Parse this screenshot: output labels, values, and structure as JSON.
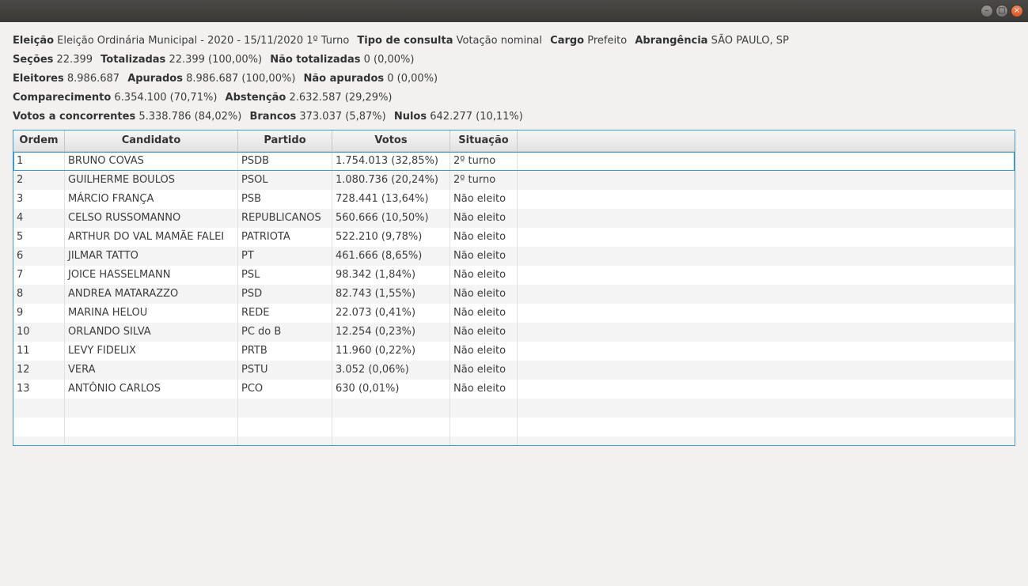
{
  "window": {
    "buttons": {
      "minimize": "–",
      "maximize": "□",
      "close": "×"
    }
  },
  "summary": {
    "line1": {
      "eleicao_label": "Eleição",
      "eleicao_value": "Eleição Ordinária Municipal - 2020 - 15/11/2020 1º Turno",
      "tipo_label": "Tipo de consulta",
      "tipo_value": "Votação nominal",
      "cargo_label": "Cargo",
      "cargo_value": "Prefeito",
      "abrangencia_label": "Abrangência",
      "abrangencia_value": "SÃO PAULO, SP"
    },
    "line2": {
      "secoes_label": "Seções",
      "secoes_value": "22.399",
      "totalizadas_label": "Totalizadas",
      "totalizadas_value": "22.399 (100,00%)",
      "nao_totalizadas_label": "Não totalizadas",
      "nao_totalizadas_value": "0 (0,00%)"
    },
    "line3": {
      "eleitores_label": "Eleitores",
      "eleitores_value": "8.986.687",
      "apurados_label": "Apurados",
      "apurados_value": "8.986.687 (100,00%)",
      "nao_apurados_label": "Não apurados",
      "nao_apurados_value": "0 (0,00%)"
    },
    "line4": {
      "comparecimento_label": "Comparecimento",
      "comparecimento_value": "6.354.100 (70,71%)",
      "abstencao_label": "Abstenção",
      "abstencao_value": "2.632.587 (29,29%)"
    },
    "line5": {
      "votos_label": "Votos a concorrentes",
      "votos_value": "5.338.786 (84,02%)",
      "brancos_label": "Brancos",
      "brancos_value": "373.037 (5,87%)",
      "nulos_label": "Nulos",
      "nulos_value": "642.277 (10,11%)"
    }
  },
  "table": {
    "columns": [
      "Ordem",
      "Candidato",
      "Partido",
      "Votos",
      "Situação"
    ],
    "rows": [
      [
        "1",
        "BRUNO COVAS",
        "PSDB",
        "1.754.013 (32,85%)",
        "2º turno"
      ],
      [
        "2",
        "GUILHERME BOULOS",
        "PSOL",
        "1.080.736 (20,24%)",
        "2º turno"
      ],
      [
        "3",
        "MÁRCIO FRANÇA",
        "PSB",
        "728.441 (13,64%)",
        "Não eleito"
      ],
      [
        "4",
        "CELSO RUSSOMANNO",
        "REPUBLICANOS",
        "560.666 (10,50%)",
        "Não eleito"
      ],
      [
        "5",
        "ARTHUR DO VAL MAMÃE FALEI",
        "PATRIOTA",
        "522.210 (9,78%)",
        "Não eleito"
      ],
      [
        "6",
        "JILMAR TATTO",
        "PT",
        "461.666 (8,65%)",
        "Não eleito"
      ],
      [
        "7",
        "JOICE HASSELMANN",
        "PSL",
        "98.342 (1,84%)",
        "Não eleito"
      ],
      [
        "8",
        "ANDREA MATARAZZO",
        "PSD",
        "82.743 (1,55%)",
        "Não eleito"
      ],
      [
        "9",
        "MARINA HELOU",
        "REDE",
        "22.073 (0,41%)",
        "Não eleito"
      ],
      [
        "10",
        "ORLANDO SILVA",
        "PC do B",
        "12.254 (0,23%)",
        "Não eleito"
      ],
      [
        "11",
        "LEVY FIDELIX",
        "PRTB",
        "11.960 (0,22%)",
        "Não eleito"
      ],
      [
        "12",
        "VERA",
        "PSTU",
        "3.052 (0,06%)",
        "Não eleito"
      ],
      [
        "13",
        "ANTÔNIO CARLOS",
        "PCO",
        "630 (0,01%)",
        "Não eleito"
      ]
    ],
    "selected_row": 0,
    "empty_rows": 3
  }
}
